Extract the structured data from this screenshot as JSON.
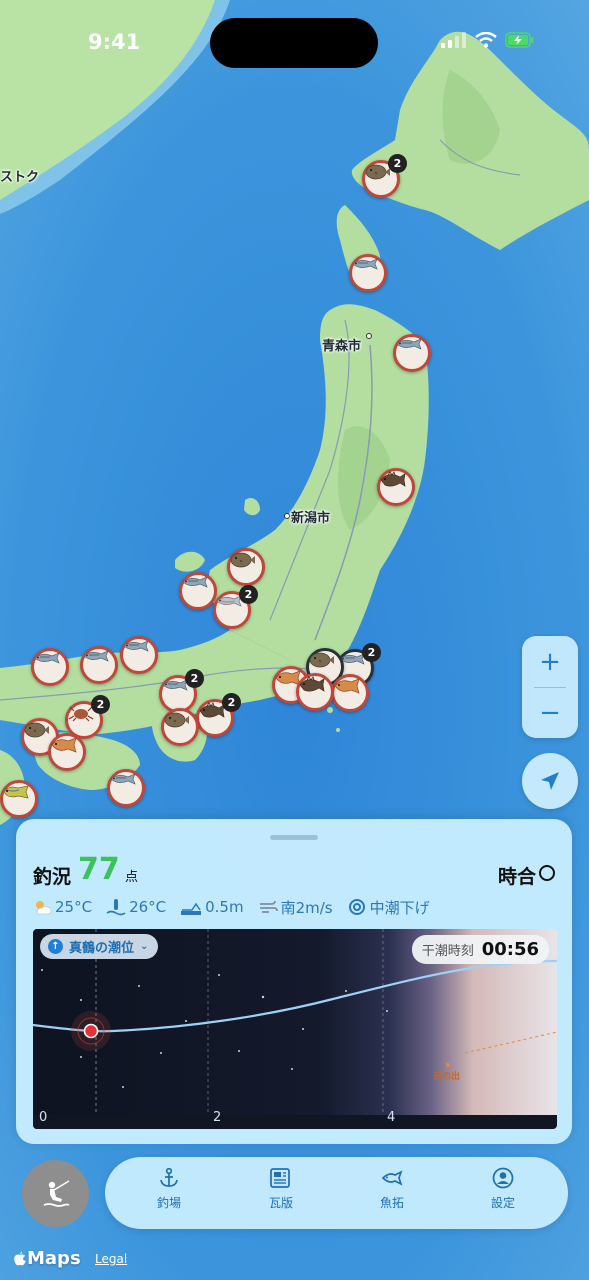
{
  "status_bar": {
    "time": "9:41"
  },
  "map": {
    "labels": {
      "vladivostok": "ストク",
      "aomori": "青森市",
      "niigata": "新潟市"
    },
    "pins": [
      {
        "id": "hokkaido-west",
        "fish": "flatfish",
        "count": "2",
        "dark": false
      },
      {
        "id": "hakodate",
        "fish": "mackerel"
      },
      {
        "id": "iwate",
        "fish": "mackerel"
      },
      {
        "id": "miyagi",
        "fish": "rockfish"
      },
      {
        "id": "noto",
        "fish": "flatfish"
      },
      {
        "id": "toyama",
        "fish": "mackerel"
      },
      {
        "id": "fukui",
        "fish": "salmon",
        "count": "2"
      },
      {
        "id": "tokyo",
        "fish": "mackerel",
        "count": "2",
        "dark": true
      },
      {
        "id": "chiba",
        "fish": "flatfish",
        "dark": true
      },
      {
        "id": "shizuoka",
        "fish": "porgy"
      },
      {
        "id": "kanagawa",
        "fish": "porgy"
      },
      {
        "id": "izu",
        "fish": "rockfish"
      },
      {
        "id": "sanin-1",
        "fish": "mackerel"
      },
      {
        "id": "sanin-2",
        "fish": "mackerel"
      },
      {
        "id": "sanin-3",
        "fish": "mackerel"
      },
      {
        "id": "kii-1",
        "fish": "mackerel",
        "count": "2"
      },
      {
        "id": "kii-2",
        "fish": "rockfish",
        "count": "2"
      },
      {
        "id": "kii-3",
        "fish": "flatfish"
      },
      {
        "id": "shikoku-1",
        "fish": "crab",
        "count": "2"
      },
      {
        "id": "shikoku-2",
        "fish": "flatfish"
      },
      {
        "id": "shikoku-3",
        "fish": "porgy"
      },
      {
        "id": "kochi",
        "fish": "mackerel"
      },
      {
        "id": "kyushu",
        "fish": "dorado"
      }
    ]
  },
  "controls": {
    "zoom_in": "+",
    "zoom_out": "−"
  },
  "sheet": {
    "condition_label": "釣況",
    "condition_score": "77",
    "condition_unit": "点",
    "jiai_label": "時合",
    "weather": [
      {
        "icon": "partly-sunny-icon",
        "value": "25°C"
      },
      {
        "icon": "water-temp-icon",
        "value": "26°C"
      },
      {
        "icon": "wave-height-icon",
        "value": "0.5m"
      },
      {
        "icon": "wind-icon",
        "value": "南2m/s"
      },
      {
        "icon": "tide-swirl-icon",
        "value": "中潮下げ"
      }
    ],
    "station": "真鶴の潮位",
    "tide_time_label": "干潮時刻",
    "tide_time_value": "00:56",
    "sunrise_label": "日の出",
    "x_ticks": [
      "0",
      "2",
      "4"
    ]
  },
  "tabs": [
    {
      "label": "釣場",
      "icon": "anchor-icon"
    },
    {
      "label": "瓦版",
      "icon": "newspaper-icon"
    },
    {
      "label": "魚拓",
      "icon": "fish-icon"
    },
    {
      "label": "設定",
      "icon": "profile-icon"
    }
  ],
  "footer": {
    "maps": "Maps",
    "legal": "Legal"
  },
  "colors": {
    "accent": "#1f7fc9",
    "score": "#3cc25a",
    "pin_border": "#c0473a",
    "land": "#a8d99a",
    "sea": "#3a8fd6"
  }
}
